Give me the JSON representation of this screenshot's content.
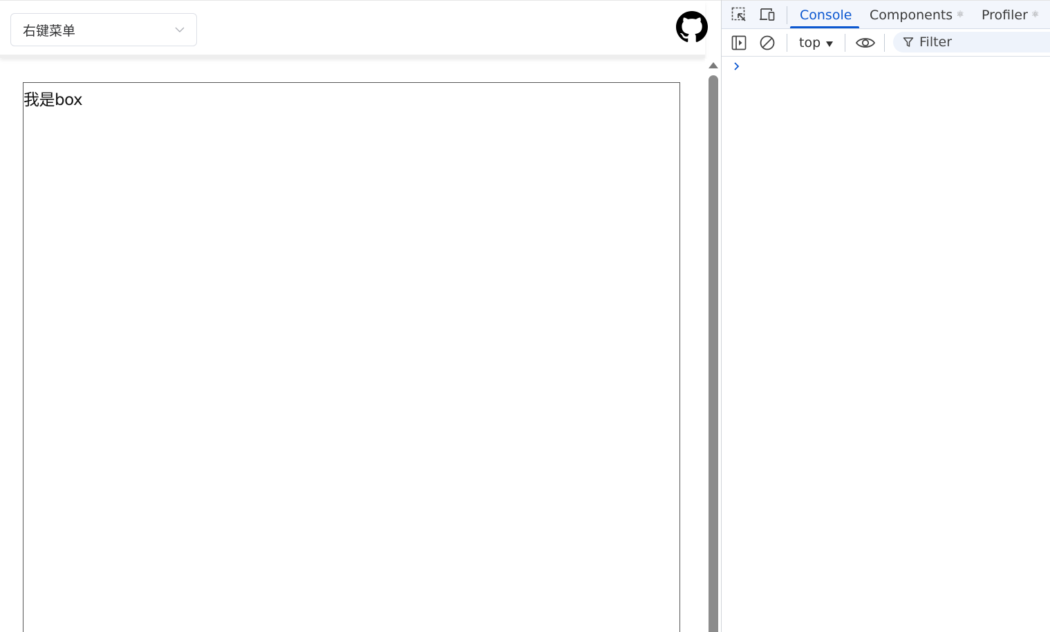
{
  "page": {
    "select": {
      "value": "右键菜单",
      "arrow_icon": "chevron-down-icon"
    },
    "github_icon": "github-icon",
    "box": {
      "text": "我是box"
    }
  },
  "devtools": {
    "tabs": [
      {
        "label": "Console",
        "active": true
      },
      {
        "label": "Components",
        "badge": "⚛"
      },
      {
        "label": "Profiler",
        "badge": "⚛"
      }
    ],
    "toolbar": {
      "context": "top",
      "filter_placeholder": "Filter"
    },
    "accent_color": "#0b57d0"
  }
}
